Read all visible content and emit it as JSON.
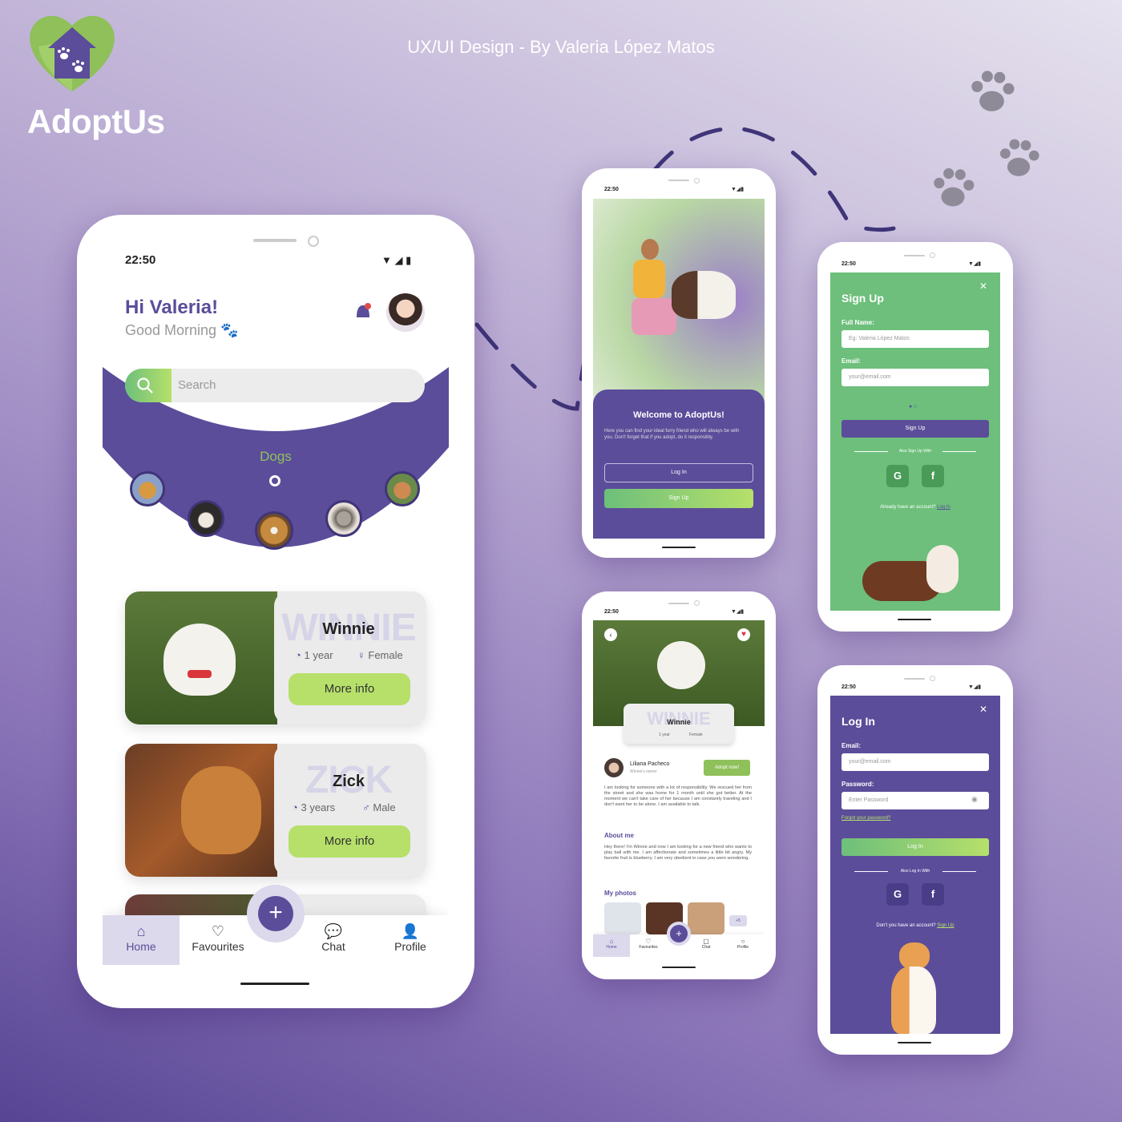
{
  "brand": {
    "name": "AdoptUs"
  },
  "credit": "UX/UI Design - By Valeria López Matos",
  "colors": {
    "purple": "#5b4d9a",
    "green": "#6dbf7b",
    "lime": "#b6e06a"
  },
  "home": {
    "time": "22:50",
    "greeting": "Hi Valeria!",
    "subgreeting": "Good Morning",
    "search_placeholder": "Search",
    "category": "Dogs",
    "pets": [
      {
        "bg": "WINNIE",
        "name": "Winnie",
        "age": "1 year",
        "gender": "Female",
        "button": "More info"
      },
      {
        "bg": "ZICK",
        "name": "Zick",
        "age": "3 years",
        "gender": "Male",
        "button": "More info"
      }
    ],
    "nav": [
      "Home",
      "Favourites",
      "Chat",
      "Profile"
    ]
  },
  "welcome": {
    "time": "22:50",
    "title": "Welcome to AdoptUs!",
    "text": "Here you can find your ideal furry friend who will always be with you. Don't forget that if you adopt, do it responsibly.",
    "login": "Log In",
    "signup": "Sign Up"
  },
  "signup": {
    "time": "22:50",
    "title": "Sign Up",
    "fullname_label": "Full Name:",
    "fullname_placeholder": "Eg: Valeria López Matos",
    "email_label": "Email:",
    "email_placeholder": "your@email.com",
    "button": "Sign Up",
    "also": "Also Sign Up With",
    "account": "Already have an account?",
    "account_link": "Log In"
  },
  "detail": {
    "time": "22:50",
    "bg": "WINNIE",
    "name": "Winnie",
    "age": "1 year",
    "gender": "Female",
    "owner": "Liliana Pacheco",
    "owner_role": "Winnie's owner",
    "adopt": "Adopt now!",
    "desc": "I am looking for someone with a lot of responsibility. We rescued her from the street and she was home for 1 month until she got better. At the moment we can't take care of her because I am constantly traveling and I don't want her to be alone. I am available to talk.",
    "about_title": "About me",
    "about": "Hey there! I'm Winnie and now I am looking for a new friend who wants to play ball with me. I am affectionate and sometimes a little bit angry. My favorite fruit is blueberry. I am very obedient in case you were wondering.",
    "photos_title": "My photos",
    "more_photos": "+5",
    "nav": [
      "Home",
      "Favourites",
      "Chat",
      "Profile"
    ]
  },
  "login": {
    "time": "22:50",
    "title": "Log In",
    "email_label": "Email:",
    "email_placeholder": "your@email.com",
    "password_label": "Password:",
    "password_placeholder": "Enter Password",
    "forgot": "Forgot your password?",
    "button": "Log In",
    "also": "Also Log In With",
    "account": "Don't you have an account?",
    "account_link": "Sign Up"
  }
}
